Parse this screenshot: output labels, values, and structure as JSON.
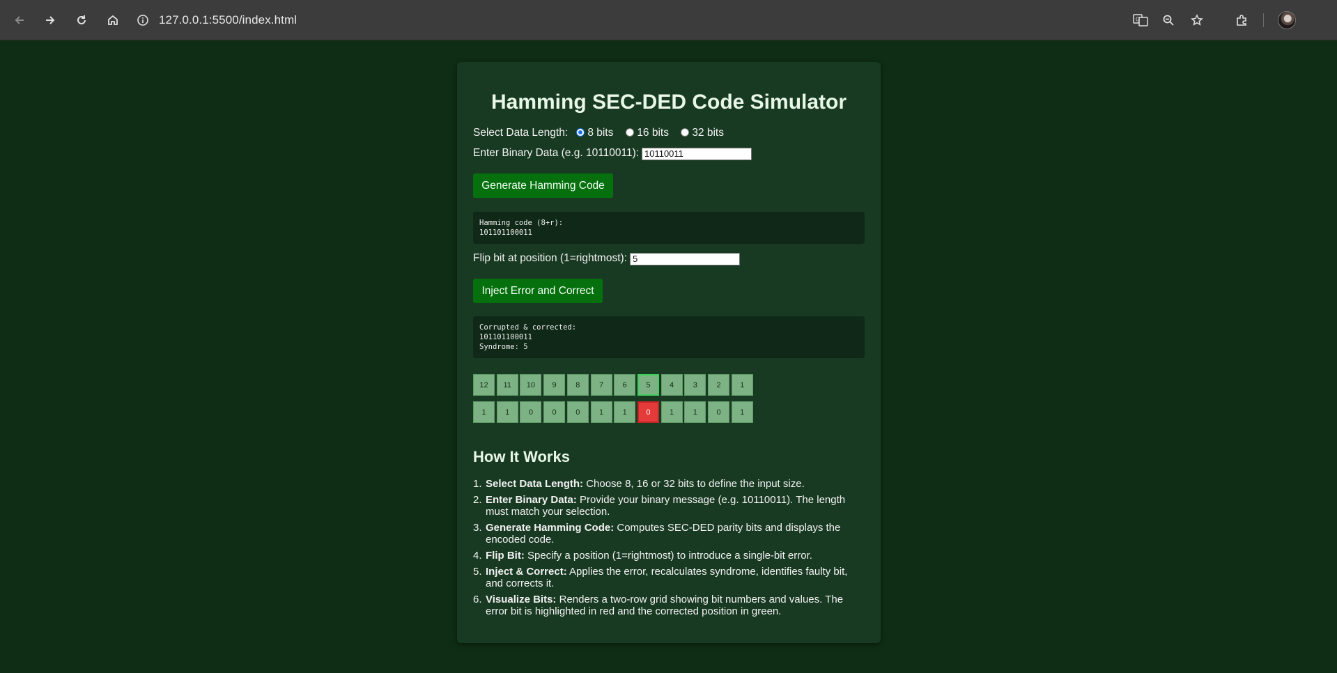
{
  "browser": {
    "url": "127.0.0.1:5500/index.html"
  },
  "app": {
    "title": "Hamming SEC-DED Code Simulator",
    "data_length_label": "Select Data Length:",
    "options": [
      "8 bits",
      "16 bits",
      "32 bits"
    ],
    "selected_option": "8 bits",
    "binary_label": "Enter Binary Data (e.g. 10110011):",
    "binary_value": "10110011",
    "generate_button": "Generate Hamming Code",
    "hamming_output_line1": "Hamming code (8+r):",
    "hamming_output_line2": "101101100011",
    "flip_label": "Flip bit at position (1=rightmost):",
    "flip_value": "5",
    "inject_button": "Inject Error and Correct",
    "corrected_line1": "Corrupted & corrected:",
    "corrected_line2": "101101100011",
    "corrected_line3": "Syndrome: 5",
    "positions": [
      "12",
      "11",
      "10",
      "9",
      "8",
      "7",
      "6",
      "5",
      "4",
      "3",
      "2",
      "1"
    ],
    "bits": [
      "1",
      "1",
      "0",
      "0",
      "0",
      "1",
      "1",
      "0",
      "1",
      "1",
      "0",
      "1"
    ],
    "corrected_position": "5",
    "error_position": "5",
    "colors": {
      "error": "#e53a3a",
      "corrected": "#3fce5a",
      "button": "#06700f"
    }
  },
  "howto": {
    "heading": "How It Works",
    "steps": [
      {
        "num": "1.",
        "bold": "Select Data Length:",
        "text": " Choose 8, 16 or 32 bits to define the input size."
      },
      {
        "num": "2.",
        "bold": "Enter Binary Data:",
        "text": " Provide your binary message (e.g. 10110011). The length must match your selection."
      },
      {
        "num": "3.",
        "bold": "Generate Hamming Code:",
        "text": " Computes SEC-DED parity bits and displays the encoded code."
      },
      {
        "num": "4.",
        "bold": "Flip Bit:",
        "text": " Specify a position (1=rightmost) to introduce a single-bit error."
      },
      {
        "num": "5.",
        "bold": "Inject & Correct:",
        "text": " Applies the error, recalculates syndrome, identifies faulty bit, and corrects it."
      },
      {
        "num": "6.",
        "bold": "Visualize Bits:",
        "text": " Renders a two-row grid showing bit numbers and values. The error bit is highlighted in red and the corrected position in green."
      }
    ]
  }
}
